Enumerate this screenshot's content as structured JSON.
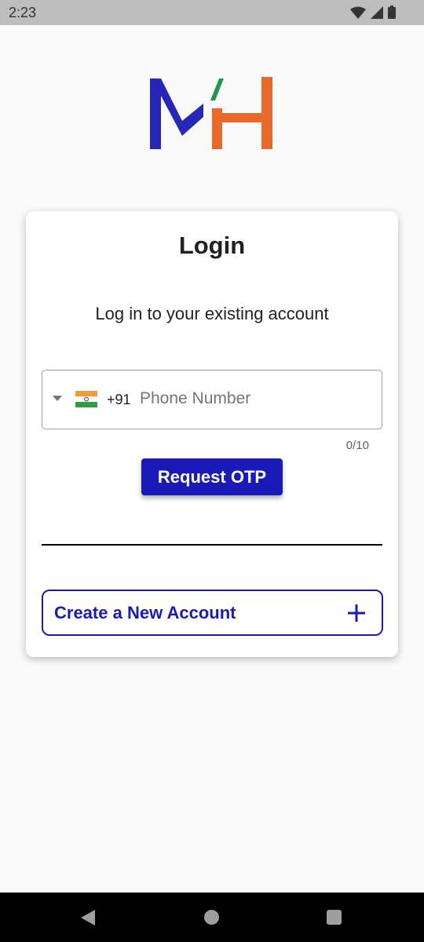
{
  "status_bar": {
    "time": "2:23",
    "icons": [
      "wifi-icon",
      "signal-icon",
      "battery-icon"
    ]
  },
  "logo": {
    "text": "MH",
    "colors": [
      "#2626b8",
      "#1a9a4a",
      "#e8692a"
    ]
  },
  "card": {
    "title": "Login",
    "subtitle": "Log in to your existing account"
  },
  "phone_input": {
    "country_flag": "india-flag-icon",
    "dial_code": "+91",
    "placeholder": "Phone Number",
    "counter": "0/10"
  },
  "request_otp": {
    "label": "Request OTP"
  },
  "create_account": {
    "label": "Create a New Account",
    "icon": "plus-icon"
  },
  "colors": {
    "primary": "#1a1ab8",
    "background": "#fafafa"
  },
  "nav_bar": {
    "icons": [
      "back-icon",
      "home-icon",
      "recents-icon"
    ]
  }
}
